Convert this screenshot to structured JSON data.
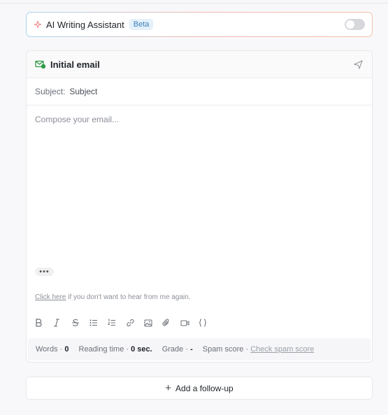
{
  "ai_assistant": {
    "title": "AI Writing Assistant",
    "badge": "Beta",
    "enabled": false
  },
  "email": {
    "header": "Initial email",
    "subject_label": "Subject:",
    "subject_value": "Subject",
    "body_placeholder": "Compose your email...",
    "dots": "•••",
    "unsubscribe_link": "Click here",
    "unsubscribe_text": " if you don't want to hear from me again."
  },
  "toolbar": {
    "icons": [
      "bold-icon",
      "italic-icon",
      "strikethrough-icon",
      "bullet-list-icon",
      "numbered-list-icon",
      "link-icon",
      "image-icon",
      "attachment-icon",
      "video-icon",
      "code-braces-icon"
    ]
  },
  "stats": {
    "words_label": "Words ·",
    "words_value": "0",
    "reading_label": "Reading time ·",
    "reading_value": "0 sec.",
    "grade_label": "Grade ·",
    "grade_value": "-",
    "spam_label": "Spam score ·",
    "spam_action": "Check spam score"
  },
  "follow_up": {
    "label": "Add a follow-up"
  },
  "colors": {
    "accent_green": "#2e9b45",
    "badge_blue": "#3b7fb8"
  }
}
